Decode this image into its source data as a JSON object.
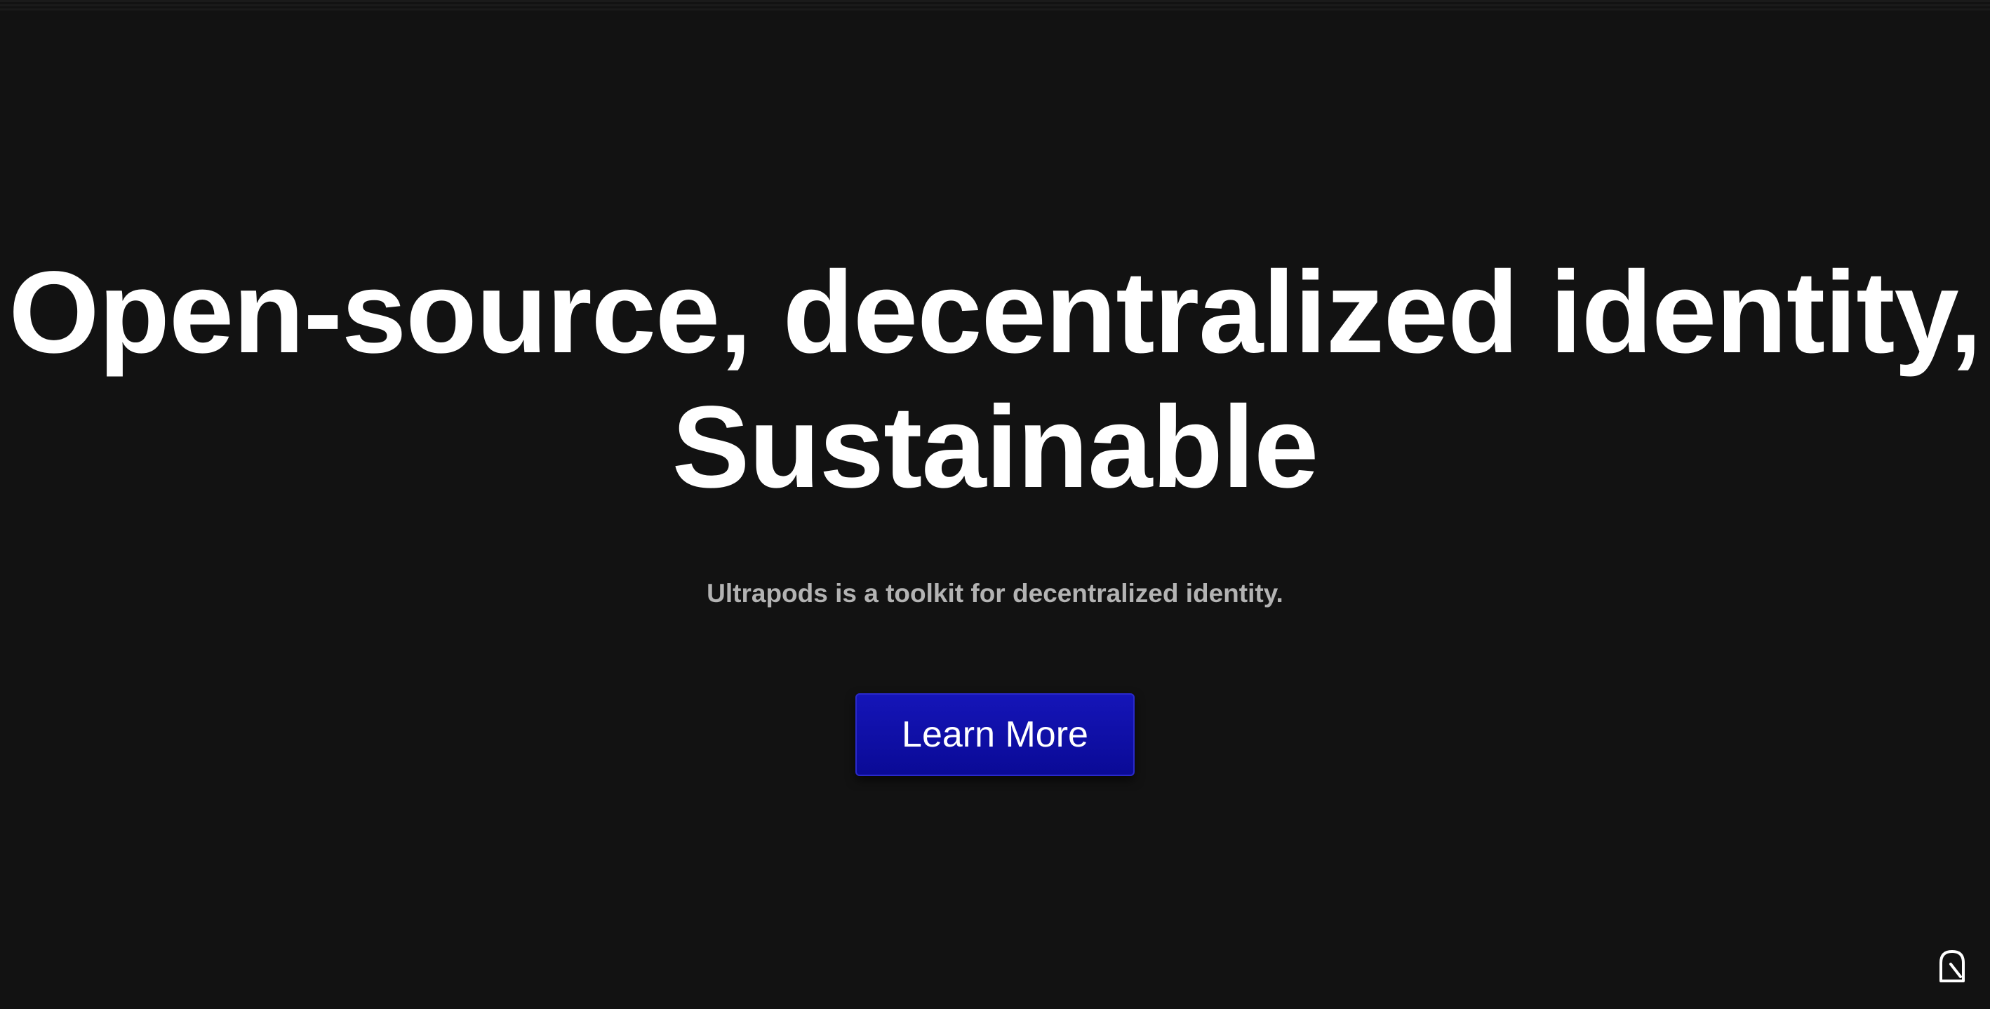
{
  "hero": {
    "headline_line1": "Open-source, decentralized identity,",
    "headline_line2": "Sustainable",
    "subtitle": "Ultrapods is a toolkit for decentralized identity.",
    "cta_label": "Learn More"
  },
  "colors": {
    "background": "#121212",
    "headline": "#ffffff",
    "subtitle": "#b3b3b3",
    "button": "#0f0fa8"
  },
  "icons": {
    "corner": "corner-widget-icon"
  }
}
